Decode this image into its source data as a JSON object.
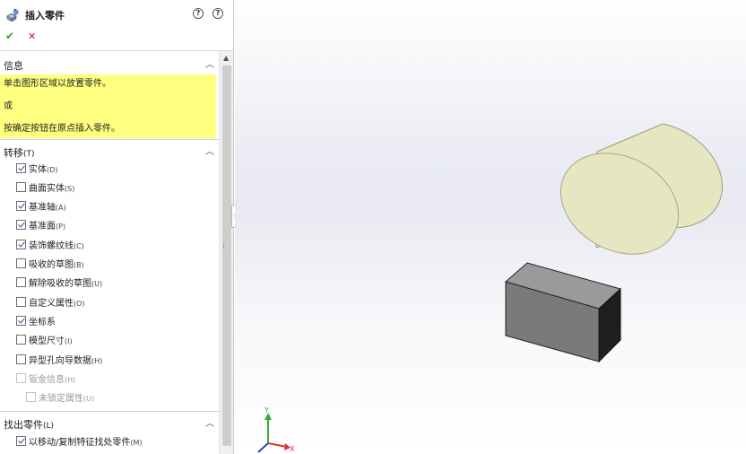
{
  "panel": {
    "title": "插入零件",
    "help_label": "?",
    "help2_label": "?",
    "ok_label": "✔",
    "cancel_label": "✕"
  },
  "info": {
    "title": "信息",
    "lines": [
      "单击图形区域以放置零件。",
      "或",
      "按确定按钮在原点插入零件。"
    ]
  },
  "transfer": {
    "title": "转移",
    "title_key": "(T)",
    "items": [
      {
        "label": "实体",
        "key": "(D)",
        "checked": true,
        "enabled": true
      },
      {
        "label": "曲面实体",
        "key": "(S)",
        "checked": false,
        "enabled": true
      },
      {
        "label": "基准轴",
        "key": "(A)",
        "checked": true,
        "enabled": true
      },
      {
        "label": "基准面",
        "key": "(P)",
        "checked": true,
        "enabled": true
      },
      {
        "label": "装饰螺纹线",
        "key": "(C)",
        "checked": true,
        "enabled": true
      },
      {
        "label": "吸收的草图",
        "key": "(B)",
        "checked": false,
        "enabled": true
      },
      {
        "label": "解除吸收的草图",
        "key": "(U)",
        "checked": false,
        "enabled": true
      },
      {
        "label": "自定义属性",
        "key": "(O)",
        "checked": false,
        "enabled": true
      },
      {
        "label": "坐标系",
        "key": "",
        "checked": true,
        "enabled": true
      },
      {
        "label": "模型尺寸",
        "key": "(I)",
        "checked": false,
        "enabled": true
      },
      {
        "label": "异型孔向导数据",
        "key": "(H)",
        "checked": false,
        "enabled": true
      },
      {
        "label": "钣金信息",
        "key": "(H)",
        "checked": false,
        "enabled": false
      },
      {
        "label": "未锁定属性",
        "key": "(U)",
        "checked": false,
        "enabled": false
      }
    ]
  },
  "find": {
    "title": "找出零件",
    "title_key": "(L)",
    "items": [
      {
        "label": "以移动/复制特征找处零件",
        "key": "(M)",
        "checked": true
      }
    ]
  },
  "viewport": {
    "triad": {
      "x_label": "X",
      "y_label": "Y"
    },
    "colors": {
      "cylinder": "#e6e6c0",
      "box_front": "#7a7a7a",
      "box_top": "#9a9a9a",
      "box_side": "#1e1e1e"
    }
  }
}
